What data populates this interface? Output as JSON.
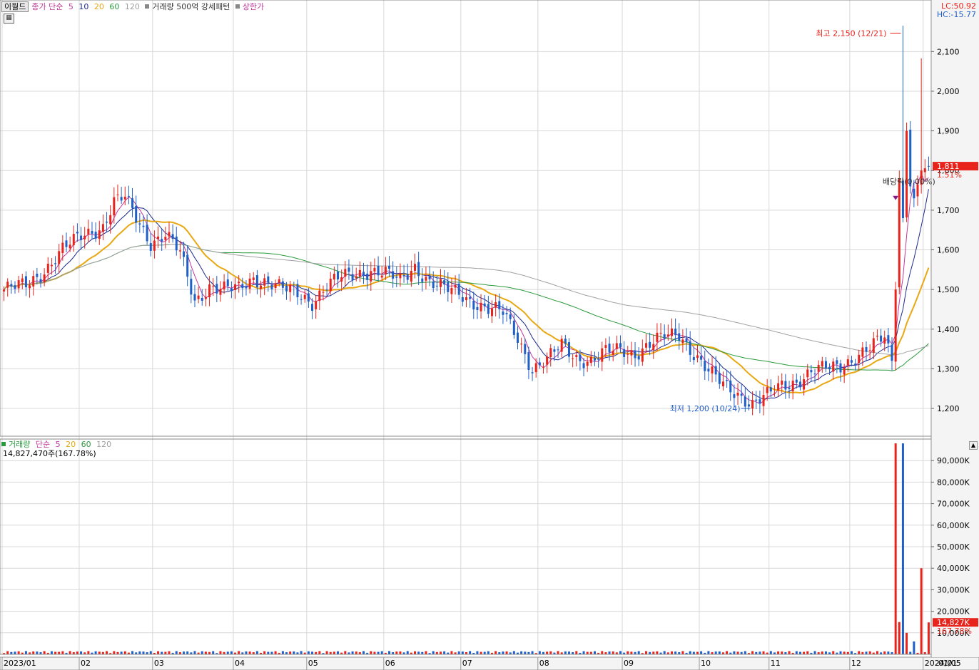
{
  "price_legend": {
    "tab": "이월드",
    "ma_title": "종가 단순",
    "ma_periods": [
      "5",
      "10",
      "20",
      "60",
      "120"
    ],
    "volume_pattern": "거래량 500억 강세패턴",
    "upper_limit": "상한가"
  },
  "lc_label": "LC:50.92",
  "hc_label": "HC:-15.77",
  "volume_legend": {
    "title": "거래량",
    "ma_title": "단순",
    "ma_periods": [
      "5",
      "20",
      "60",
      "120"
    ],
    "summary": "14,827,470주(167.78%)"
  },
  "colors": {
    "up": "#e8231c",
    "down": "#1f5fc8",
    "ma5": "#c0389c",
    "ma10": "#1c2a8c",
    "ma20": "#e8a812",
    "ma60": "#2a9a3c",
    "ma120": "#a0a0a0",
    "grid": "#d8d8d8"
  },
  "chart_data": {
    "type": "candlestick",
    "price_axis": {
      "ticks": [
        "1,200",
        "1,300",
        "1,400",
        "1,500",
        "1,600",
        "1,700",
        "1,800",
        "1,900",
        "2,000",
        "2,100"
      ],
      "range": [
        1130,
        2230
      ]
    },
    "volume_axis": {
      "ticks": [
        "10,000K",
        "20,000K",
        "30,000K",
        "40,000K",
        "50,000K",
        "60,000K",
        "70,000K",
        "80,000K",
        "90,000K"
      ],
      "range": [
        0,
        100000
      ]
    },
    "x_labels": [
      "2023/01",
      "02",
      "03",
      "04",
      "05",
      "06",
      "07",
      "08",
      "09",
      "10",
      "11",
      "12",
      "2024/01",
      "01/05"
    ],
    "current_price": "1,811",
    "current_change": "1.51%",
    "current_volume": "14,827K",
    "current_volume_pct": "167.78%",
    "high_annotation": "최고 2,150 (12/21)",
    "low_annotation": "최저 1,200 (10/24)",
    "dividend_annotation": "배당락(0.00%)",
    "price_anchors": [
      [
        0,
        1500
      ],
      [
        6,
        1510
      ],
      [
        10,
        1540
      ],
      [
        16,
        1600
      ],
      [
        22,
        1640
      ],
      [
        27,
        1660
      ],
      [
        30,
        1720
      ],
      [
        33,
        1730
      ],
      [
        36,
        1680
      ],
      [
        40,
        1620
      ],
      [
        44,
        1640
      ],
      [
        48,
        1590
      ],
      [
        52,
        1470
      ],
      [
        56,
        1510
      ],
      [
        60,
        1500
      ],
      [
        64,
        1500
      ],
      [
        68,
        1530
      ],
      [
        72,
        1520
      ],
      [
        76,
        1500
      ],
      [
        80,
        1490
      ],
      [
        84,
        1470
      ],
      [
        88,
        1510
      ],
      [
        92,
        1530
      ],
      [
        96,
        1540
      ],
      [
        100,
        1550
      ],
      [
        104,
        1540
      ],
      [
        108,
        1520
      ],
      [
        112,
        1560
      ],
      [
        116,
        1520
      ],
      [
        120,
        1500
      ],
      [
        124,
        1490
      ],
      [
        128,
        1470
      ],
      [
        132,
        1450
      ],
      [
        136,
        1440
      ],
      [
        140,
        1380
      ],
      [
        144,
        1300
      ],
      [
        148,
        1320
      ],
      [
        152,
        1360
      ],
      [
        156,
        1330
      ],
      [
        160,
        1320
      ],
      [
        164,
        1340
      ],
      [
        168,
        1350
      ],
      [
        172,
        1340
      ],
      [
        176,
        1360
      ],
      [
        180,
        1380
      ],
      [
        184,
        1390
      ],
      [
        188,
        1340
      ],
      [
        192,
        1290
      ],
      [
        196,
        1260
      ],
      [
        200,
        1240
      ],
      [
        204,
        1210
      ],
      [
        208,
        1230
      ],
      [
        212,
        1260
      ],
      [
        216,
        1270
      ],
      [
        220,
        1290
      ],
      [
        224,
        1300
      ],
      [
        228,
        1310
      ],
      [
        232,
        1330
      ],
      [
        236,
        1350
      ],
      [
        240,
        1380
      ],
      [
        242,
        1320
      ],
      [
        243,
        1500
      ],
      [
        244,
        1780
      ],
      [
        245,
        1680
      ],
      [
        246,
        1900
      ],
      [
        247,
        1760
      ],
      [
        248,
        1730
      ],
      [
        250,
        1800
      ],
      [
        252,
        1811
      ]
    ],
    "volume_series": [
      [
        243,
        98000
      ],
      [
        244,
        15000
      ],
      [
        245,
        98000
      ],
      [
        246,
        10000
      ],
      [
        248,
        6000
      ],
      [
        250,
        40000
      ],
      [
        252,
        14827
      ]
    ]
  }
}
